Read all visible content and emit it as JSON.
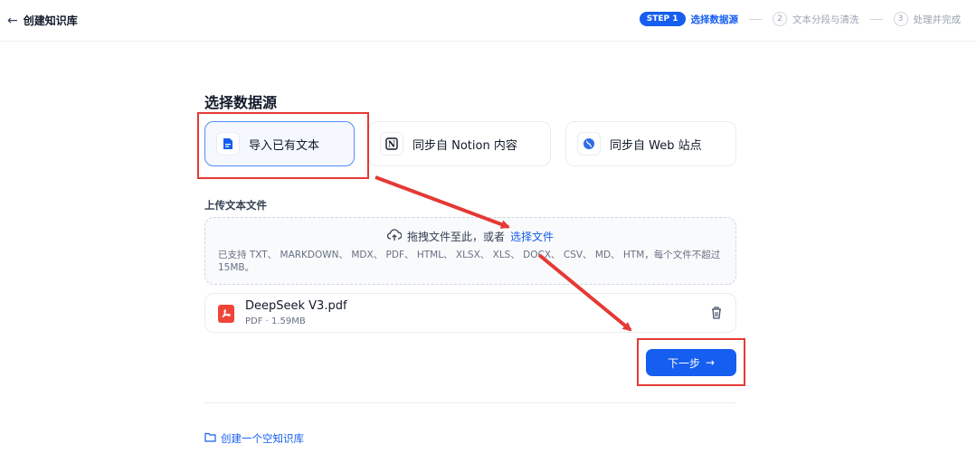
{
  "header": {
    "back_arrow": "←",
    "title": "创建知识库",
    "steps": [
      {
        "badge": "STEP 1",
        "label": "选择数据源"
      },
      {
        "number": "2",
        "label": "文本分段与清洗"
      },
      {
        "number": "3",
        "label": "处理并完成"
      }
    ]
  },
  "main": {
    "heading": "选择数据源",
    "sources": [
      {
        "label": "导入已有文本",
        "icon": "document-icon"
      },
      {
        "label": "同步自 Notion 内容",
        "icon": "notion-icon"
      },
      {
        "label": "同步自 Web 站点",
        "icon": "globe-icon"
      }
    ],
    "upload_label": "上传文本文件",
    "dropzone": {
      "text": "拖拽文件至此，或者",
      "link": "选择文件",
      "hint": "已支持 TXT、 MARKDOWN、 MDX、 PDF、 HTML、 XLSX、 XLS、 DOCX、 CSV、 MD、 HTM，每个文件不超过 15MB。"
    },
    "file": {
      "name": "DeepSeek V3.pdf",
      "meta": "PDF · 1.59MB",
      "icon": "pdf-file-icon"
    },
    "next_button": "下一步",
    "next_arrow": "→",
    "create_empty": "创建一个空知识库"
  },
  "annotation_color": "#e53935",
  "accent_color": "#155eef"
}
